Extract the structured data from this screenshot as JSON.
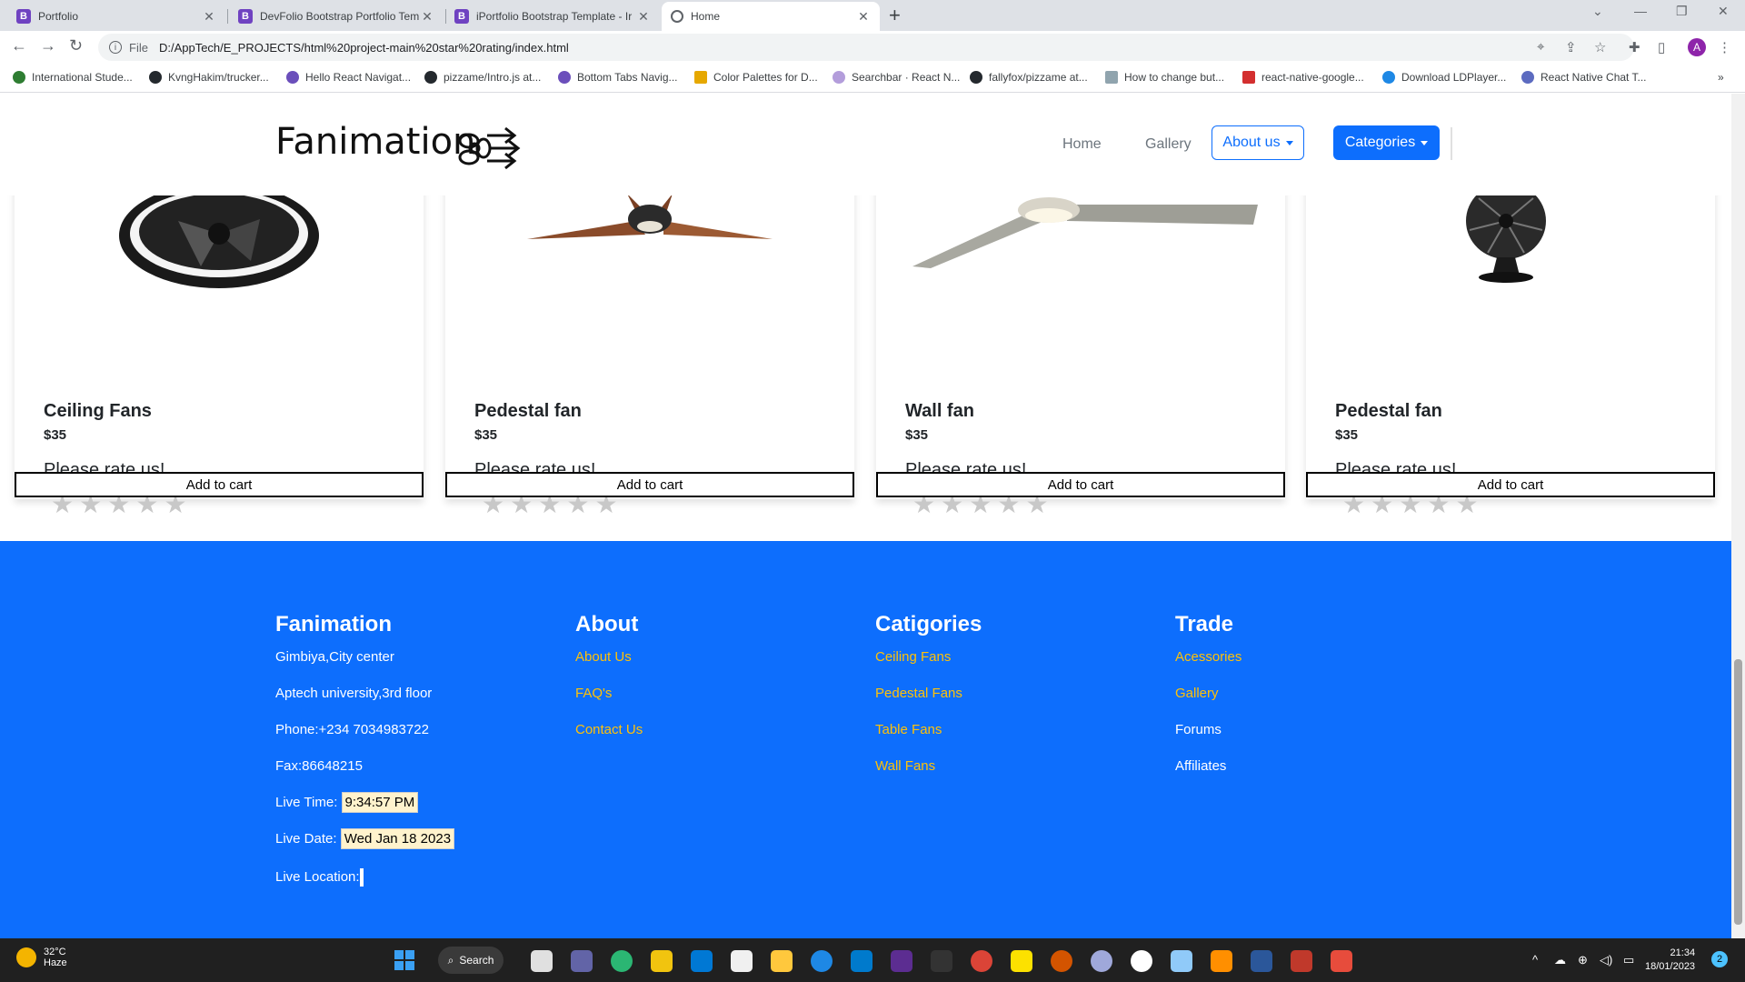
{
  "browser": {
    "tabs": [
      {
        "title": "Portfolio",
        "favicon": "bootstrap-icon"
      },
      {
        "title": "DevFolio Bootstrap Portfolio Tem",
        "favicon": "bootstrap-icon"
      },
      {
        "title": "iPortfolio Bootstrap Template - Ir",
        "favicon": "bootstrap-icon"
      },
      {
        "title": "Home",
        "favicon": "globe-icon"
      }
    ],
    "file_label": "File",
    "url": "D:/AppTech/E_PROJECTS/html%20project-main%20star%20rating/index.html",
    "profile_initial": "A",
    "bookmarks": [
      "International Stude...",
      "KvngHakim/trucker...",
      "Hello React Navigat...",
      "pizzame/Intro.js at...",
      "Bottom Tabs Navig...",
      "Color Palettes for D...",
      "Searchbar · React N...",
      "fallyfox/pizzame at...",
      "How to change but...",
      "react-native-google...",
      "Download LDPlayer...",
      "React Native Chat T..."
    ]
  },
  "navbar": {
    "brand": "Fanimation",
    "links": [
      "Home",
      "Gallery"
    ],
    "about_btn": "About us",
    "categories_btn": "Categories"
  },
  "products": [
    {
      "name": "Ceiling Fans",
      "price": "$35",
      "rate_prompt": "Please rate us!",
      "button": "Add to cart",
      "rating": 0
    },
    {
      "name": "Pedestal fan",
      "price": "$35",
      "rate_prompt": "Please rate us!",
      "button": "Add to cart",
      "rating": 0
    },
    {
      "name": "Wall fan",
      "price": "$35",
      "rate_prompt": "Please rate us!",
      "button": "Add to cart",
      "rating": 0
    },
    {
      "name": "Pedestal fan",
      "price": "$35",
      "rate_prompt": "Please rate us!",
      "button": "Add to cart",
      "rating": 0
    }
  ],
  "footer": {
    "col1": {
      "title": "Fanimation",
      "address1": "Gimbiya,City center",
      "address2": "Aptech university,3rd floor",
      "phone": "Phone:+234 7034983722",
      "fax": "Fax:86648215",
      "time_label": "Live Time:",
      "time_value": "9:34:57 PM",
      "date_label": "Live Date:",
      "date_value": "Wed Jan 18 2023",
      "location_label": "Live Location:"
    },
    "col2": {
      "title": "About",
      "items": [
        "About Us",
        "FAQ's",
        "Contact Us"
      ]
    },
    "col3": {
      "title": "Catigories",
      "items": [
        "Ceiling Fans",
        "Pedestal Fans",
        "Table Fans",
        "Wall Fans"
      ]
    },
    "col4": {
      "title": "Trade",
      "items": [
        "Acessories",
        "Gallery",
        "Forums",
        "Affiliates"
      ]
    }
  },
  "taskbar": {
    "temperature": "32°C",
    "weather": "Haze",
    "search": "Search",
    "time": "21:34",
    "date": "18/01/2023",
    "notifications": "2"
  },
  "colors": {
    "primary": "#0d6efd",
    "link_yellow": "#ffc107",
    "star_empty": "#c8c8c8"
  }
}
